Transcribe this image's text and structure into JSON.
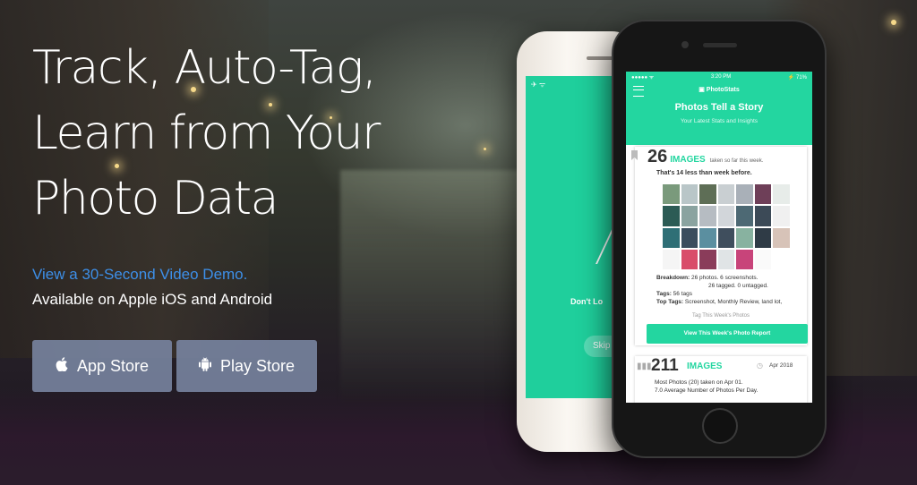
{
  "hero": {
    "headline": "Track, Auto-Tag,\nLearn from Your\nPhoto Data",
    "video_link": "View a 30-Second Video Demo.",
    "availability": "Available on Apple iOS and Android",
    "buttons": [
      {
        "label": "App Store",
        "icon": "apple-icon"
      },
      {
        "label": "Play Store",
        "icon": "android-icon"
      }
    ]
  },
  "colors": {
    "accent": "#23d6a0",
    "link": "#3d8fe8",
    "button_bg": "#7884a0"
  },
  "back_phone": {
    "partial_text": "Don't Lo",
    "skip_label": "Skip"
  },
  "front_phone": {
    "status": {
      "time": "3:20 PM",
      "battery": "71%"
    },
    "brand": "PhotoStats",
    "title": "Photos Tell a Story",
    "subtitle": "Your Latest Stats and Insights",
    "week_card": {
      "count": "26",
      "count_label": "IMAGES",
      "count_sub": "taken so far this week.",
      "compare": "That's 14 less than week before.",
      "breakdown_label": "Breakdown:",
      "breakdown_1": "26 photos. 6 screenshots.",
      "breakdown_2": "26 tagged. 0 untagged.",
      "tags_label": "Tags:",
      "tags_value": "56 tags",
      "top_tags_label": "Top Tags:",
      "top_tags_value": "Screenshot, Monthly Review, land lot,",
      "tag_week": "Tag This Week's Photos",
      "report_button": "View This Week's Photo Report"
    },
    "month_card": {
      "count": "211",
      "count_label": "IMAGES",
      "date": "Apr 2018",
      "line1": "Most Photos (20) taken on Apr 01.",
      "line2": "7.0 Average Number of Photos Per Day."
    }
  }
}
